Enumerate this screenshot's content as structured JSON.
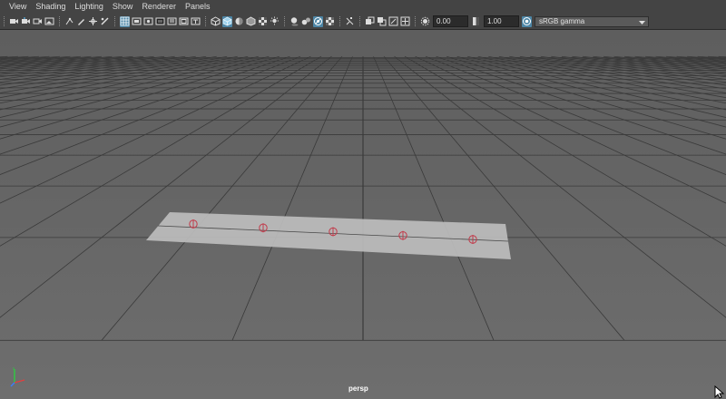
{
  "menu": [
    "View",
    "Shading",
    "Lighting",
    "Show",
    "Renderer",
    "Panels"
  ],
  "toolbar": {
    "groups": [
      [
        "camera-icon",
        "camera-attributes-icon",
        "bookmark-icon",
        "image-plane-icon"
      ],
      [
        "2d-pan-zoom-icon",
        "grease-pencil-icon",
        "transform-manip-icon",
        "grid-toggle-icon"
      ],
      [
        "grid-icon",
        "film-gate-icon",
        "resolution-gate-icon",
        "gate-mask-icon",
        "field-chart-icon",
        "safe-action-icon",
        "safe-title-icon"
      ],
      [
        "wireframe-icon",
        "smooth-shade-icon",
        "default-material-icon",
        "shade-wire-icon",
        "textured-icon",
        "lights-icon"
      ],
      [
        "shadows-icon",
        "ambient-occlusion-icon",
        "xray-icon",
        "backface-culling-icon"
      ],
      [
        "xray-joints-icon",
        "isolate-select-icon",
        "camera-look-icon"
      ]
    ],
    "exposure_value": "0.00",
    "gamma_value": "1.00",
    "color_space": "sRGB gamma"
  },
  "viewport": {
    "camera_label": "persp",
    "background": "#6b6b6b",
    "grid_color": "#3a3a3a",
    "plane_color": "#bdbdbd",
    "joint_color": "#c23a4a",
    "joints_count": 5
  },
  "colors": {
    "accent": "#4d86a6",
    "panel": "#444444"
  }
}
